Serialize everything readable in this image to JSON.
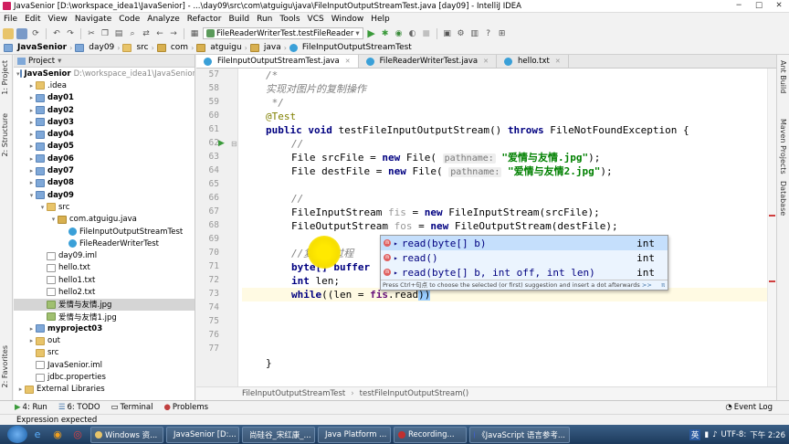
{
  "title": {
    "text": "JavaSenior [D:\\workspace_idea1\\JavaSenior] - ...\\day09\\src\\com\\atguigu\\java\\FileInputOutputStreamTest.java [day09] - IntelliJ IDEA"
  },
  "menu": [
    "File",
    "Edit",
    "View",
    "Navigate",
    "Code",
    "Analyze",
    "Refactor",
    "Build",
    "Run",
    "Tools",
    "VCS",
    "Window",
    "Help"
  ],
  "toolbar": {
    "run_config": "FileReaderWriterTest.testFileReader"
  },
  "nav": {
    "crumbs": [
      "JavaSenior",
      "day09",
      "src",
      "com",
      "atguigu",
      "java",
      "FileInputOutputStreamTest"
    ]
  },
  "left_strip": {
    "project": "1: Project",
    "structure": "2: Structure",
    "favorites": "2: Favorites"
  },
  "right_strip": {
    "ant": "Ant Build",
    "maven": "Maven Projects",
    "db": "Database"
  },
  "project": {
    "header": "Project",
    "root": {
      "name": "JavaSenior",
      "path": "D:\\workspace_idea1\\JavaSenior"
    },
    "items": [
      {
        "label": ".idea",
        "indent": 1,
        "icon": "folder",
        "tw": "▸",
        "bold": false
      },
      {
        "label": "day01",
        "indent": 1,
        "icon": "mod",
        "tw": "▸",
        "bold": true
      },
      {
        "label": "day02",
        "indent": 1,
        "icon": "mod",
        "tw": "▸",
        "bold": true
      },
      {
        "label": "day03",
        "indent": 1,
        "icon": "mod",
        "tw": "▸",
        "bold": true
      },
      {
        "label": "day04",
        "indent": 1,
        "icon": "mod",
        "tw": "▸",
        "bold": true
      },
      {
        "label": "day05",
        "indent": 1,
        "icon": "mod",
        "tw": "▸",
        "bold": true
      },
      {
        "label": "day06",
        "indent": 1,
        "icon": "mod",
        "tw": "▸",
        "bold": true
      },
      {
        "label": "day07",
        "indent": 1,
        "icon": "mod",
        "tw": "▸",
        "bold": true
      },
      {
        "label": "day08",
        "indent": 1,
        "icon": "mod",
        "tw": "▸",
        "bold": true
      },
      {
        "label": "day09",
        "indent": 1,
        "icon": "mod",
        "tw": "▾",
        "bold": true
      },
      {
        "label": "src",
        "indent": 2,
        "icon": "folder",
        "tw": "▾",
        "bold": false
      },
      {
        "label": "com.atguigu.java",
        "indent": 3,
        "icon": "pkg",
        "tw": "▾",
        "bold": false
      },
      {
        "label": "FileInputOutputStreamTest",
        "indent": 4,
        "icon": "jfile",
        "tw": "",
        "bold": false
      },
      {
        "label": "FileReaderWriterTest",
        "indent": 4,
        "icon": "jfile",
        "tw": "",
        "bold": false
      },
      {
        "label": "day09.iml",
        "indent": 2,
        "icon": "txtf",
        "tw": "",
        "bold": false
      },
      {
        "label": "hello.txt",
        "indent": 2,
        "icon": "txtf",
        "tw": "",
        "bold": false
      },
      {
        "label": "hello1.txt",
        "indent": 2,
        "icon": "txtf",
        "tw": "",
        "bold": false
      },
      {
        "label": "hello2.txt",
        "indent": 2,
        "icon": "txtf",
        "tw": "",
        "bold": false
      },
      {
        "label": "爱情与友情.jpg",
        "indent": 2,
        "icon": "img",
        "tw": "",
        "bold": false,
        "selected": true
      },
      {
        "label": "爱情与友情1.jpg",
        "indent": 2,
        "icon": "img",
        "tw": "",
        "bold": false
      },
      {
        "label": "myproject03",
        "indent": 1,
        "icon": "mod",
        "tw": "▸",
        "bold": true
      },
      {
        "label": "out",
        "indent": 1,
        "icon": "folder",
        "tw": "▸",
        "bold": false
      },
      {
        "label": "src",
        "indent": 1,
        "icon": "folder",
        "tw": "",
        "bold": false
      },
      {
        "label": "JavaSenior.iml",
        "indent": 1,
        "icon": "txtf",
        "tw": "",
        "bold": false
      },
      {
        "label": "jdbc.properties",
        "indent": 1,
        "icon": "txtf",
        "tw": "",
        "bold": false
      },
      {
        "label": "External Libraries",
        "indent": 0,
        "icon": "folder",
        "tw": "▸",
        "bold": false
      }
    ]
  },
  "tabs": [
    {
      "label": "FileInputOutputStreamTest.java",
      "active": true
    },
    {
      "label": "FileReaderWriterTest.java",
      "active": false
    },
    {
      "label": "hello.txt",
      "active": false
    }
  ],
  "code": {
    "lines": [
      "57",
      "58",
      "59",
      "60",
      "61",
      "62",
      "63",
      "64",
      "65",
      "66",
      "67",
      "68",
      "69",
      "70",
      "71",
      "72",
      "73",
      "74",
      "75",
      "76",
      "77"
    ],
    "l57": "/*",
    "l58": "实现对图片的复制操作",
    "l59": " */",
    "l60": "@Test",
    "l61a": "public void ",
    "l61b": "testFileInputOutputStream",
    "l61c": "() ",
    "l61d": "throws ",
    "l61e": "FileNotFoundException {",
    "l62": "//",
    "l63a": "File srcFile = ",
    "l63b": "new ",
    "l63c": "File( ",
    "l63h": "pathname:",
    "l63s": " \"爱情与友情.jpg\"",
    "l63e": ");",
    "l64a": "File destFile = ",
    "l64b": "new ",
    "l64c": "File( ",
    "l64h": "pathname:",
    "l64s": " \"爱情与友情2.jpg\"",
    "l64e": ");",
    "l66": "//",
    "l67a": "FileInputStream ",
    "l67v": "fis",
    "l67b": " = ",
    "l67k": "new ",
    "l67c": "FileInputStream(srcFile);",
    "l68a": "FileOutputStream ",
    "l68v": "fos",
    "l68b": " = ",
    "l68k": "new ",
    "l68c": "FileOutputStream(destFile);",
    "l70": "//复制的过程",
    "l71": "byte[] buffer",
    "l72a": "int ",
    "l72b": "len;",
    "l73a": "while",
    "l73b": "((len = ",
    "l73v": "fis",
    "l73c": ".read",
    "l73d": "))",
    "l76": "}"
  },
  "popup": {
    "items": [
      {
        "name": "read(byte[] b)",
        "type": "int",
        "selected": true
      },
      {
        "name": "read()",
        "type": "int",
        "selected": false
      },
      {
        "name": "read(byte[] b, int off, int len)",
        "type": "int",
        "selected": false
      }
    ],
    "footer": "Press Ctrl+句点 to choose the selected (or first) suggestion and insert a dot afterwards",
    "footer_link": ">>",
    "footer_icon": "π"
  },
  "editor_breadcrumb": {
    "class": "FileInputOutputStreamTest",
    "method": "testFileInputOutputStream()"
  },
  "bottom": {
    "run": "4: Run",
    "todo": "6: TODO",
    "terminal": "Terminal",
    "problems": "Problems",
    "eventlog": "Event Log"
  },
  "status": {
    "text": "Expression expected"
  },
  "taskbar": {
    "buttons": [
      "Windows 资...",
      "JavaSenior [D:...",
      "尚硅谷_宋红康_...",
      "Java Platform ...",
      "Recording...",
      "《JavaScript 语言参考..."
    ],
    "lang": "英",
    "time": "下午 2:26",
    "encoding": "UTF-8:"
  },
  "colors": {
    "accent": "#3c8fd0",
    "keyword": "#000080",
    "string": "#008000",
    "comment": "#808080"
  }
}
